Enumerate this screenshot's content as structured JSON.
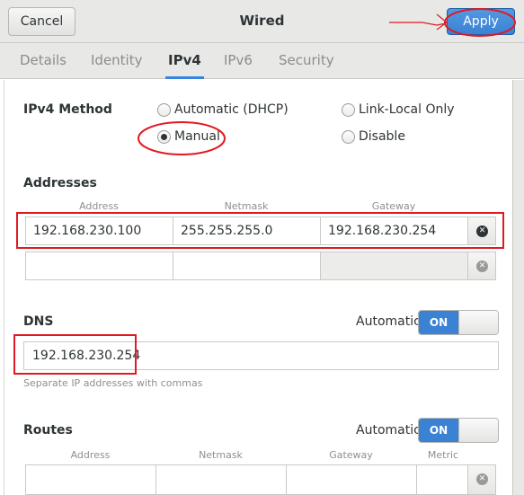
{
  "header": {
    "cancel_label": "Cancel",
    "title": "Wired",
    "apply_label": "Apply"
  },
  "tabs": [
    {
      "label": "Details",
      "active": false
    },
    {
      "label": "Identity",
      "active": false
    },
    {
      "label": "IPv4",
      "active": true
    },
    {
      "label": "IPv6",
      "active": false
    },
    {
      "label": "Security",
      "active": false
    }
  ],
  "ipv4_method": {
    "label": "IPv4 Method",
    "options": [
      {
        "label": "Automatic (DHCP)",
        "checked": false
      },
      {
        "label": "Link-Local Only",
        "checked": false
      },
      {
        "label": "Manual",
        "checked": true
      },
      {
        "label": "Disable",
        "checked": false
      }
    ]
  },
  "addresses": {
    "heading": "Addresses",
    "columns": [
      "Address",
      "Netmask",
      "Gateway"
    ],
    "rows": [
      {
        "address": "192.168.230.100",
        "netmask": "255.255.255.0",
        "gateway": "192.168.230.254"
      },
      {
        "address": "",
        "netmask": "",
        "gateway": ""
      }
    ]
  },
  "dns": {
    "heading": "DNS",
    "automatic_label": "Automatic",
    "switch_label": "ON",
    "value": "192.168.230.254",
    "hint": "Separate IP addresses with commas"
  },
  "routes": {
    "heading": "Routes",
    "automatic_label": "Automatic",
    "switch_label": "ON",
    "columns": [
      "Address",
      "Netmask",
      "Gateway",
      "Metric"
    ]
  },
  "colors": {
    "accent": "#3584e4",
    "annotation": "#e01a22"
  }
}
